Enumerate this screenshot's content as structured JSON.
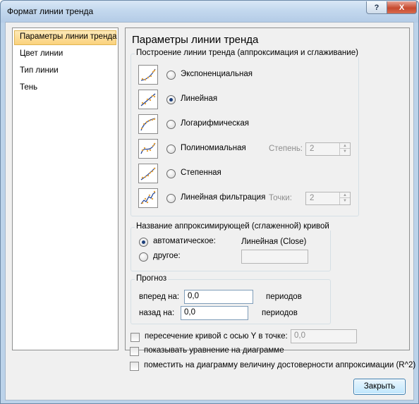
{
  "window": {
    "title": "Формат линии тренда",
    "help_label": "?",
    "close_label": "X"
  },
  "nav": {
    "items": [
      {
        "label": "Параметры линии тренда",
        "selected": true
      },
      {
        "label": "Цвет линии",
        "selected": false
      },
      {
        "label": "Тип линии",
        "selected": false
      },
      {
        "label": "Тень",
        "selected": false
      }
    ]
  },
  "panel": {
    "title": "Параметры линии тренда",
    "trend_group": {
      "title": "Построение линии тренда (аппроксимация и сглаживание)",
      "options": [
        {
          "label": "Экспоненциальная",
          "icon": "exponential-trend-icon",
          "checked": false
        },
        {
          "label": "Линейная",
          "icon": "linear-trend-icon",
          "checked": true
        },
        {
          "label": "Логарифмическая",
          "icon": "logarithmic-trend-icon",
          "checked": false
        },
        {
          "label": "Полиномиальная",
          "icon": "polynomial-trend-icon",
          "checked": false
        },
        {
          "label": "Степенная",
          "icon": "power-trend-icon",
          "checked": false
        },
        {
          "label": "Линейная фильтрация",
          "icon": "moving-average-trend-icon",
          "checked": false
        }
      ],
      "degree_label": "Степень:",
      "degree_value": "2",
      "points_label": "Точки:",
      "points_value": "2"
    },
    "name_group": {
      "title": "Название аппроксимирующей (сглаженной) кривой",
      "auto_label": "автоматическое:",
      "auto_value": "Линейная (Close)",
      "custom_label": "другое:",
      "custom_value": ""
    },
    "forecast_group": {
      "title": "Прогноз",
      "forward_label": "вперед на:",
      "forward_value": "0,0",
      "forward_unit": "периодов",
      "backward_label": "назад на:",
      "backward_value": "0,0",
      "backward_unit": "периодов"
    },
    "checkboxes": {
      "intercept_label": "пересечение кривой с осью Y в точке:",
      "intercept_value": "0,0",
      "equation_label": "показывать уравнение на диаграмме",
      "rsquared_label": "поместить на диаграмму величину достоверности аппроксимации (R^2)"
    }
  },
  "footer": {
    "close_button_label": "Закрыть"
  },
  "colors": {
    "selection": "#fbd27c",
    "radio_dot": "#1d3f7a",
    "trend_dots": "#e6a23c",
    "trend_line": "#1f3f8f",
    "close_button": "#c64a2f"
  }
}
